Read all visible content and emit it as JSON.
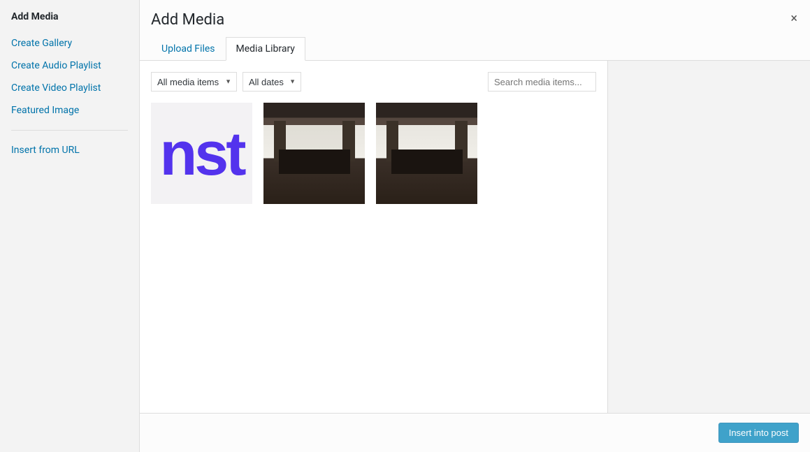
{
  "modal": {
    "title": "Add Media",
    "close_label": "×"
  },
  "sidebar": {
    "heading": "Add Media",
    "items": [
      {
        "label": "Create Gallery"
      },
      {
        "label": "Create Audio Playlist"
      },
      {
        "label": "Create Video Playlist"
      },
      {
        "label": "Featured Image"
      }
    ],
    "insert_url_label": "Insert from URL"
  },
  "tabs": {
    "upload": "Upload Files",
    "library": "Media Library",
    "active": "library"
  },
  "filters": {
    "type_selected": "All media items",
    "date_selected": "All dates"
  },
  "search": {
    "placeholder": "Search media items..."
  },
  "attachments": [
    {
      "kind": "logo",
      "selected": false
    },
    {
      "kind": "room-dim",
      "selected": false
    },
    {
      "kind": "room-bright",
      "selected": false
    }
  ],
  "footer": {
    "primary_button": "Insert into post"
  },
  "colors": {
    "link": "#0073aa",
    "brand": "#5333ed",
    "primary_btn": "#0085ba"
  }
}
